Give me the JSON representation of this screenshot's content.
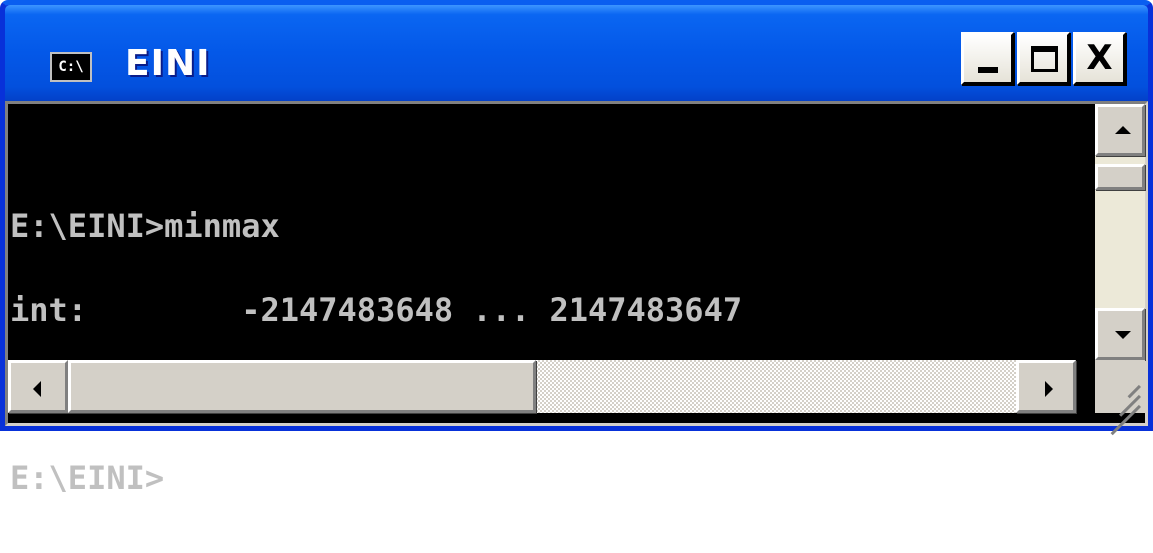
{
  "window": {
    "title": "EINI",
    "icon_label": "C:\\",
    "icon": "console-icon",
    "title_bar_color": "#0458e8",
    "frame_color": "#0831d9"
  },
  "caption_buttons": {
    "minimize_icon": "minimize-icon",
    "maximize_icon": "maximize-icon",
    "close_icon": "close-icon",
    "close_label": "X"
  },
  "console": {
    "background": "#000000",
    "foreground": "#c0c0c0",
    "lines": [
      "E:\\EINI>minmax",
      "int:        -2147483648 ... 2147483647",
      "",
      "E:\\EINI>"
    ]
  },
  "scrollbars": {
    "up_icon": "arrow-up-icon",
    "down_icon": "arrow-down-icon",
    "left_icon": "arrow-left-icon",
    "right_icon": "arrow-right-icon"
  }
}
